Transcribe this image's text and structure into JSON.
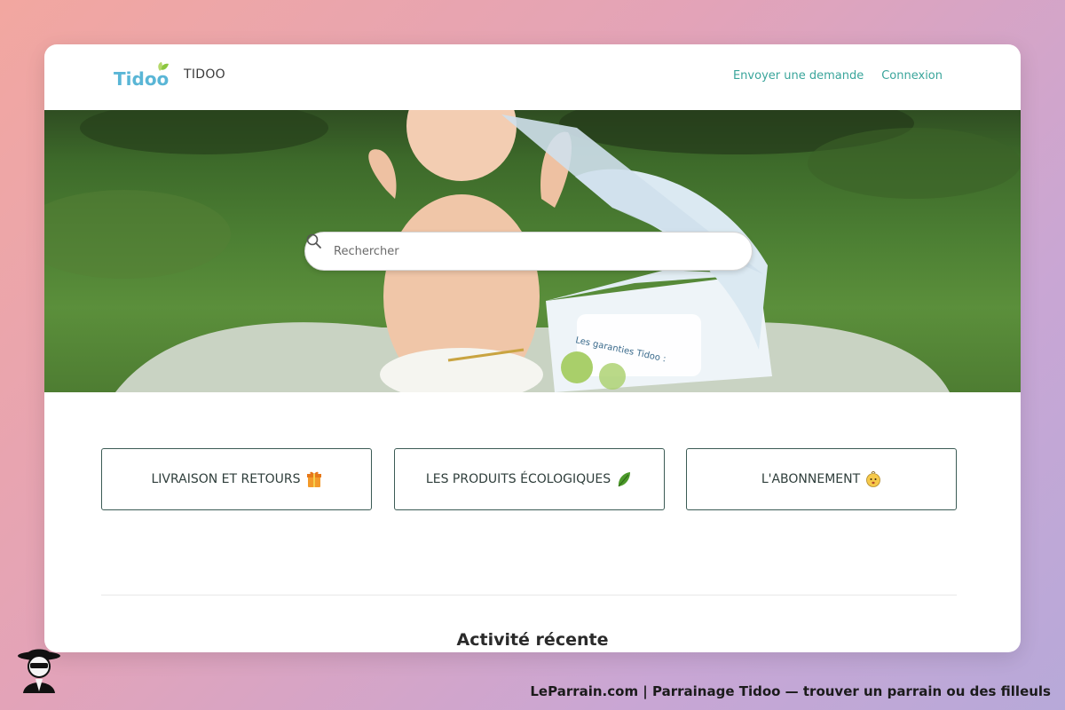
{
  "header": {
    "logo_text": "Tidoo",
    "brand_name": "TIDOO",
    "nav": {
      "send_request": "Envoyer une demande",
      "login": "Connexion"
    }
  },
  "hero": {
    "search_placeholder": "Rechercher",
    "box_text": "Les garanties Tidoo :"
  },
  "categories": [
    {
      "label": "LIVRAISON ET RETOURS",
      "icon": "gift-box-icon"
    },
    {
      "label": "LES PRODUITS ÉCOLOGIQUES",
      "icon": "leaf-icon"
    },
    {
      "label": "L'ABONNEMENT",
      "icon": "baby-face-icon"
    }
  ],
  "recent_activity": {
    "title": "Activité récente"
  },
  "footer": {
    "caption": "LeParrain.com | Parrainage Tidoo — trouver un parrain ou des filleuls"
  },
  "colors": {
    "accent": "#3aa59b",
    "border": "#3b5b55",
    "background_gradient_start": "#f2a7a0",
    "background_gradient_end": "#b7a9d9"
  }
}
